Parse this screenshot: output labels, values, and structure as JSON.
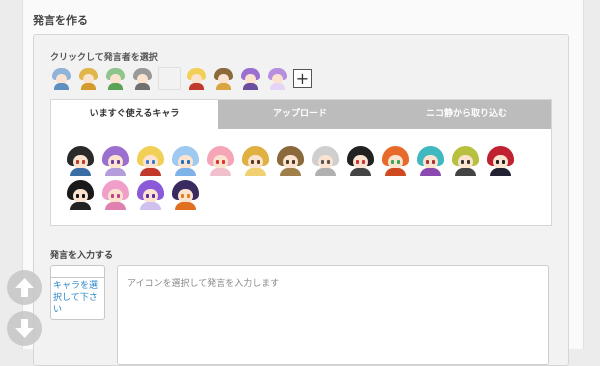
{
  "page": {
    "section_title": "発言を作る"
  },
  "speaker_select": {
    "label": "クリックして発言者を選択",
    "speakers": [
      {
        "name": "silhouette-blue",
        "hair": "#8fb3d9",
        "body": "#5f8fc0"
      },
      {
        "name": "silhouette-gold",
        "hair": "#e0b54a",
        "body": "#d49a2c"
      },
      {
        "name": "silhouette-green",
        "hair": "#8fc48c",
        "body": "#5aa256"
      },
      {
        "name": "silhouette-gray",
        "hair": "#9a9a9a",
        "body": "#707070"
      },
      {
        "name": "blank",
        "hair": "#e8e8e8",
        "body": "#e8e8e8"
      },
      {
        "name": "blonde-girl",
        "hair": "#f2cf57",
        "body": "#c0392b"
      },
      {
        "name": "brown-hat-girl",
        "hair": "#8a6a3a",
        "body": "#d9a441"
      },
      {
        "name": "purple-girl-1",
        "hair": "#9b6fd0",
        "body": "#6a4d9e"
      },
      {
        "name": "purple-girl-2",
        "hair": "#b78ee0",
        "body": "#e5d4f5"
      }
    ],
    "add_label": "+"
  },
  "tabs": [
    {
      "label": "いますぐ使えるキャラ"
    },
    {
      "label": "アップロード"
    },
    {
      "label": "ニコ静から取り込む"
    }
  ],
  "characters": [
    {
      "hair": "#2a2a2a",
      "eye": "#c0392b",
      "body": "#3a6ea5"
    },
    {
      "hair": "#9b6fd0",
      "eye": "#6a3da0",
      "body": "#b39ddb"
    },
    {
      "hair": "#f2cf57",
      "eye": "#3a7bd5",
      "body": "#c0392b"
    },
    {
      "hair": "#9ec9f0",
      "eye": "#2a6fb8",
      "body": "#7fb3e8"
    },
    {
      "hair": "#f4a6b8",
      "eye": "#d33",
      "body": "#f0c0cc"
    },
    {
      "hair": "#e0b040",
      "eye": "#5a3a1a",
      "body": "#f0d070"
    },
    {
      "hair": "#8a6a3a",
      "eye": "#4a3a20",
      "body": "#a0804a"
    },
    {
      "hair": "#cfcfcf",
      "eye": "#555",
      "body": "#b0b0b0"
    },
    {
      "hair": "#222222",
      "eye": "#c33",
      "body": "#444"
    },
    {
      "hair": "#e86a2a",
      "eye": "#3a5",
      "body": "#d04a20"
    },
    {
      "hair": "#3fb8c0",
      "eye": "#a33",
      "body": "#8a4ab0"
    },
    {
      "hair": "#b8c040",
      "eye": "#333",
      "body": "#444"
    },
    {
      "hair": "#c02030",
      "eye": "#222",
      "body": "#223"
    },
    {
      "hair": "#1a1a1a",
      "eye": "#111",
      "body": "#222"
    },
    {
      "hair": "#f0a0c8",
      "eye": "#c0408a",
      "body": "#e080b0"
    },
    {
      "hair": "#8a5ad8",
      "eye": "#5a2aa0",
      "body": "#d0c0f0"
    },
    {
      "hair": "#3a2a60",
      "eye": "#e08020",
      "body": "#e07020"
    }
  ],
  "input": {
    "label": "発言を入力する",
    "char_select_text": "キャラを選択して下さい",
    "placeholder": "アイコンを選択して発言を入力します"
  },
  "scroll": {
    "up_icon": "arrow-up-icon",
    "down_icon": "arrow-down-icon"
  }
}
